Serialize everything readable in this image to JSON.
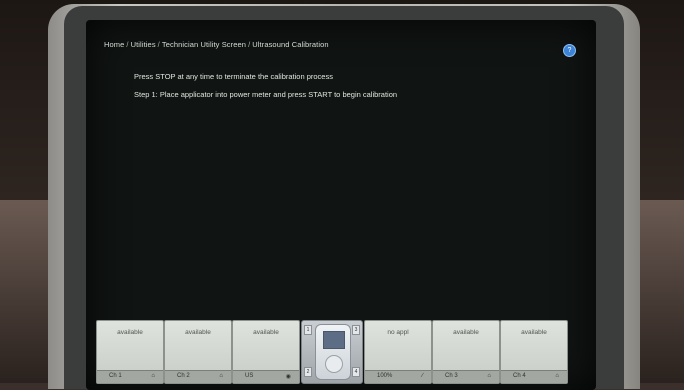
{
  "breadcrumb": [
    "Home",
    "Utilities",
    "Technician Utility Screen",
    "Ultrasound Calibration"
  ],
  "help_icon": "help-icon",
  "instructions": {
    "line1": "Press STOP at any time to terminate the calibration process",
    "line2": "Step 1: Place applicator into power meter and press START to begin calibration"
  },
  "channels": [
    {
      "status": "available",
      "label": "Ch 1",
      "icon": "plug-icon"
    },
    {
      "status": "available",
      "label": "Ch 2",
      "icon": "plug-icon"
    },
    {
      "status": "available",
      "label": "US",
      "icon": "ultrasound-icon"
    },
    {
      "status": "no appl",
      "label": "100%",
      "icon": "wand-icon"
    },
    {
      "status": "available",
      "label": "Ch 3",
      "icon": "plug-icon"
    },
    {
      "status": "available",
      "label": "Ch 4",
      "icon": "plug-icon"
    }
  ],
  "dock": {
    "left_numbers": [
      "1",
      "2"
    ],
    "right_numbers": [
      "3",
      "4"
    ]
  }
}
